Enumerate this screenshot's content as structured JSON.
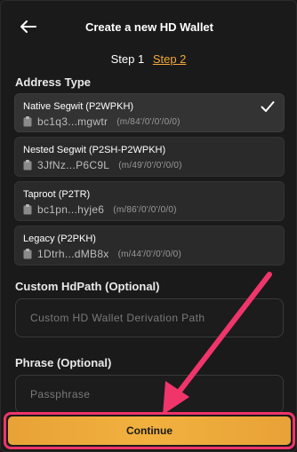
{
  "header": {
    "title": "Create a new HD Wallet",
    "step1": "Step 1",
    "step2": "Step 2"
  },
  "address_type": {
    "label": "Address Type",
    "options": [
      {
        "name": "Native Segwit (P2WPKH)",
        "address": "bc1q3...mgwtr",
        "path": "(m/84'/0'/0'/0/0)",
        "selected": true
      },
      {
        "name": "Nested Segwit (P2SH-P2WPKH)",
        "address": "3JfNz...P6C9L",
        "path": "(m/49'/0'/0'/0/0)",
        "selected": false
      },
      {
        "name": "Taproot (P2TR)",
        "address": "bc1pn...hyje6",
        "path": "(m/86'/0'/0'/0/0)",
        "selected": false
      },
      {
        "name": "Legacy (P2PKH)",
        "address": "1Dtrh...dMB8x",
        "path": "(m/44'/0'/0'/0/0)",
        "selected": false
      }
    ]
  },
  "custom_hdpath": {
    "label": "Custom HdPath (Optional)",
    "value": "",
    "placeholder": "Custom HD Wallet Derivation Path"
  },
  "phrase": {
    "label": "Phrase (Optional)",
    "value": "",
    "placeholder": "Passphrase"
  },
  "continue_button": {
    "label": "Continue"
  },
  "colors": {
    "accent": "#f2a83a",
    "annotation": "#f0356a",
    "background": "#1a1a1a"
  },
  "icons": {
    "back": "arrow-left-icon",
    "copy": "clipboard-icon",
    "selected": "checkmark-icon"
  }
}
